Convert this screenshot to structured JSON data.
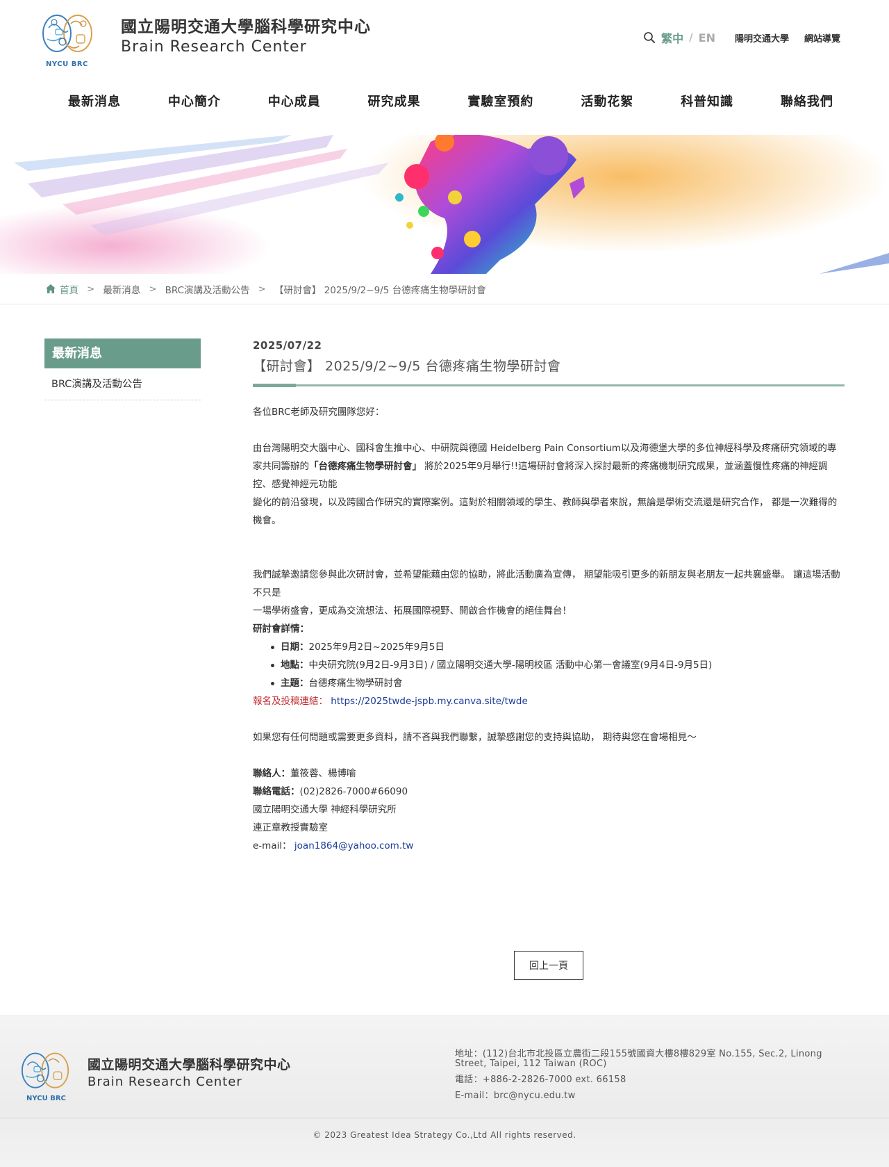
{
  "header": {
    "logo_label": "NYCU BRC",
    "title_cn": "國立陽明交通大學腦科學研究中心",
    "title_en": "Brain Research Center",
    "lang_zh": "繁中",
    "lang_sep": "/",
    "lang_en": "EN",
    "link_university": "陽明交通大學",
    "link_sitemap": "網站導覽"
  },
  "nav": [
    "最新消息",
    "中心簡介",
    "中心成員",
    "研究成果",
    "實驗室預約",
    "活動花絮",
    "科普知識",
    "聯絡我們"
  ],
  "breadcrumb": {
    "home": "首頁",
    "sep": ">",
    "level1": "最新消息",
    "level2": "BRC演講及活動公告",
    "current": "【研討會】 2025/9/2~9/5 台德疼痛生物學研討會"
  },
  "sidebar": {
    "title": "最新消息",
    "items": [
      "BRC演講及活動公告"
    ]
  },
  "article": {
    "date": "2025/07/22",
    "title": "【研討會】 2025/9/2~9/5 台德疼痛生物學研討會",
    "greeting": "各位BRC老師及研究團隊您好：",
    "p1_a": "由台灣陽明交大腦中心、國科會生推中心、中研院與德國 Heidelberg Pain Consortium以及海德堡大學的多位神經科學及疼痛研究領域的專家共同籌辦的",
    "p1_bold": "「台德疼痛生物學研討會」",
    "p1_b": " 將於2025年9月舉行!!這場研討會將深入探討最新的疼痛機制研究成果，並涵蓋慢性疼痛的神經調控、感覺神經元功能",
    "p1_c": "變化的前沿發現，以及跨國合作研究的實際案例。這對於相關領域的學生、教師與學者來說，無論是學術交流還是研究合作， 都是一次難得的機會。",
    "p2_a": "我們誠摯邀請您參與此次研討會，並希望能藉由您的協助，將此活動廣為宣傳， 期望能吸引更多的新朋友與老朋友一起共襄盛舉。 讓這場活動不只是",
    "p2_b": "一場學術盛會，更成為交流想法、拓展國際視野、開啟合作機會的絕佳舞台！",
    "details_label": "研討會詳情：",
    "details": [
      {
        "label": "日期：",
        "value": "2025年9月2日~2025年9月5日"
      },
      {
        "label": "地點：",
        "value": "中央研究院(9月2日-9月3日) / 國立陽明交通大學-陽明校區 活動中心第一會議室(9月4日-9月5日)"
      },
      {
        "label": "主題：",
        "value": "台德疼痛生物學研討會"
      }
    ],
    "register_label": "報名及投稿連結：",
    "register_url": "https://2025twde-jspb.my.canva.site/twde",
    "closing": "如果您有任何問題或需要更多資料，請不吝與我們聯繫，誠摯感謝您的支持與協助， 期待與您在會場相見～",
    "contact_label": "聯絡人：",
    "contact_value": "董筱蓉、楊博喻",
    "phone_label": "聯絡電話：",
    "phone_value": "(02)2826-7000#66090",
    "dept": "國立陽明交通大學 神經科學研究所",
    "lab": "連正章教授實驗室",
    "email_label": "e-mail： ",
    "email_value": "joan1864@yahoo.com.tw"
  },
  "back_button": "回上一頁",
  "footer": {
    "logo_label": "NYCU BRC",
    "title_cn": "國立陽明交通大學腦科學研究中心",
    "title_en": "Brain Research Center",
    "address": "地址：(112)台北市北投區立農街二段155號國資大樓8樓829室 No.155, Sec.2, Linong Street, Taipei, 112 Taiwan (ROC)",
    "phone": "電話：+886-2-2826-7000 ext. 66158",
    "email": "E-mail：brc@nycu.edu.tw",
    "copyright": "© 2023 Greatest Idea Strategy Co.,Ltd All rights reserved."
  }
}
